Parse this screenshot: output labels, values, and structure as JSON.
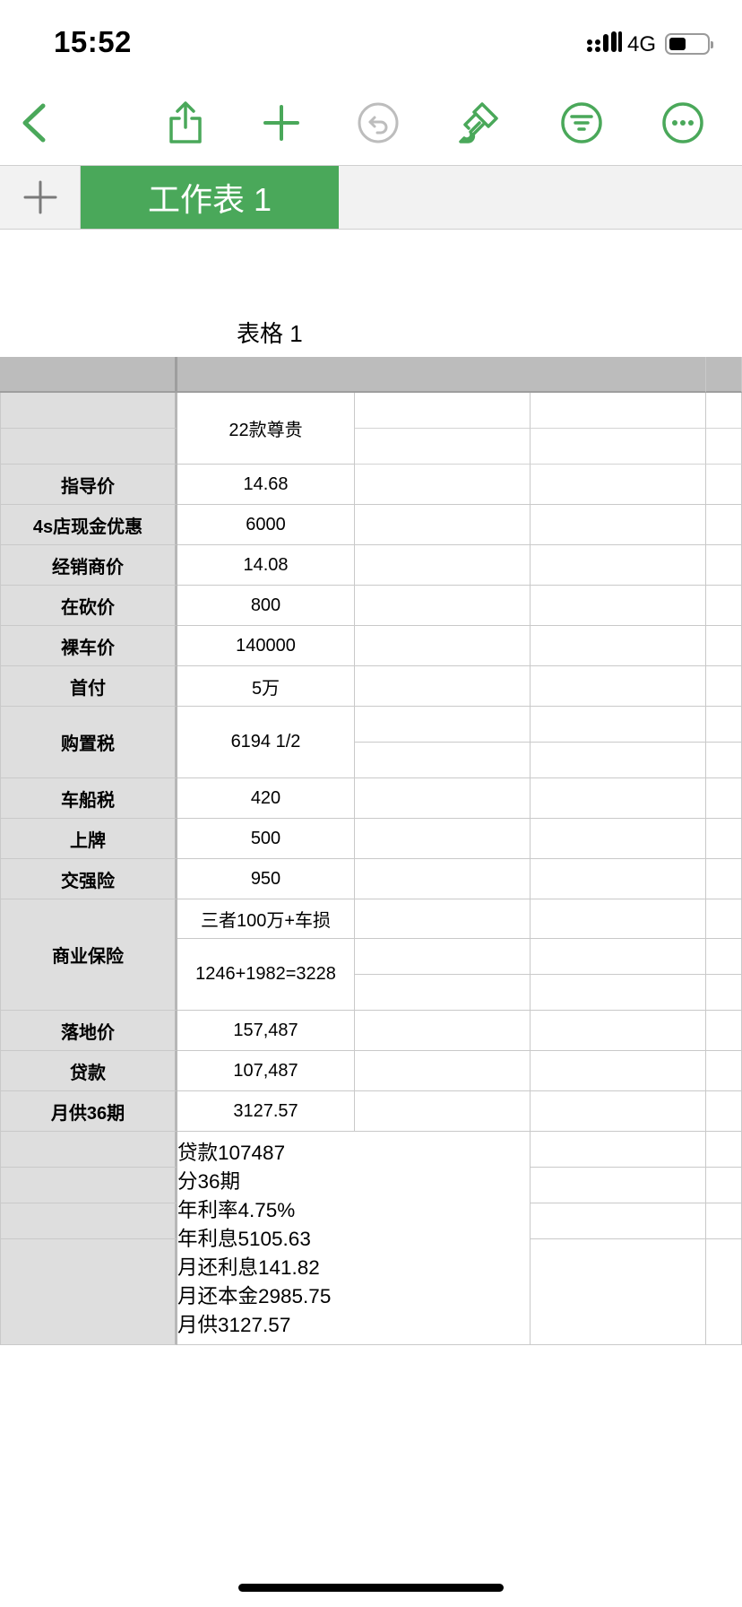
{
  "status_bar": {
    "time": "15:52",
    "network": "4G"
  },
  "toolbar": {
    "icons": [
      "back-icon",
      "share-icon",
      "add-icon",
      "undo-icon",
      "format-brush-icon",
      "filter-icon",
      "more-icon"
    ],
    "accent": "#4aa85a",
    "disabled": "#bdbdbd"
  },
  "tabs": {
    "add": "+",
    "active_sheet": "工作表 1"
  },
  "table": {
    "title": "表格 1",
    "rows": [
      {
        "label": "",
        "value": "22款尊贵"
      },
      {
        "label": "指导价",
        "value": "14.68"
      },
      {
        "label": "4s店现金优惠",
        "value": "6000"
      },
      {
        "label": "经销商价",
        "value": "14.08"
      },
      {
        "label": "在砍价",
        "value": "800"
      },
      {
        "label": "裸车价",
        "value": "140000"
      },
      {
        "label": "首付",
        "value": "5万"
      },
      {
        "label": "购置税",
        "value": "6194 1/2"
      },
      {
        "label": "车船税",
        "value": "420"
      },
      {
        "label": "上牌",
        "value": "500"
      },
      {
        "label": "交强险",
        "value": "950"
      },
      {
        "label": "商业保险",
        "value": "三者100万+车损",
        "value2": "1246+1982=3228"
      },
      {
        "label": "落地价",
        "value": "157,487"
      },
      {
        "label": "贷款",
        "value": "107,487"
      },
      {
        "label": "月供36期",
        "value": "3127.57"
      }
    ],
    "loan_note": [
      "贷款107487",
      "分36期",
      "年利率4.75%",
      "年利息5105.63",
      "月还利息141.82",
      "月还本金2985.75",
      "月供3127.57"
    ],
    "colors": {
      "header": "#dedede",
      "grid": "#c9c9c9",
      "top_bar": "#bcbcbc"
    }
  }
}
